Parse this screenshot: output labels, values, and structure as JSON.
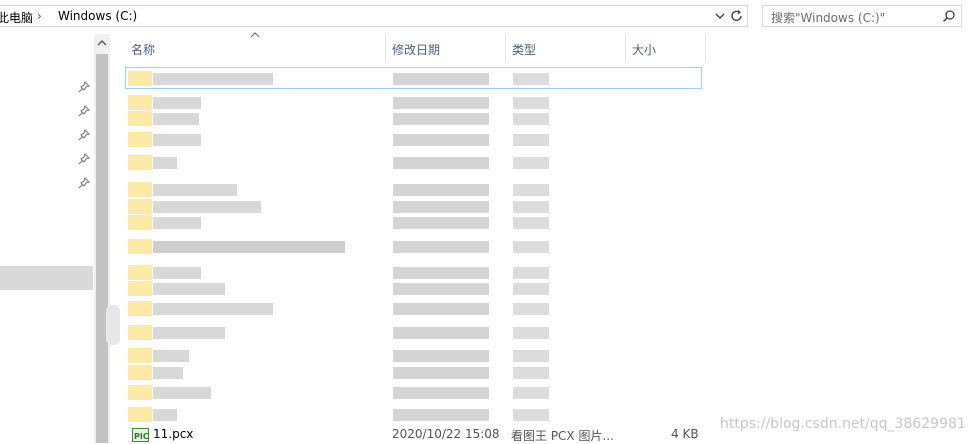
{
  "address": {
    "crumbs": [
      "此电脑",
      "Windows (C:)"
    ]
  },
  "search": {
    "placeholder": "搜索\"Windows (C:)\""
  },
  "columns": {
    "name": "名称",
    "date": "修改日期",
    "type": "类型",
    "size": "大小"
  },
  "file": {
    "name": "11.pcx",
    "date": "2020/10/22 15:08",
    "type": "看图王 PCX 图片...",
    "size": "4 KB"
  },
  "watermark": "https://blog.csdn.net/qq_38629981",
  "colors": {
    "header_text": "#4c607a",
    "folder": "#fde9a8",
    "focus_border": "#99d1ff"
  },
  "icons": {
    "pin": "pin-icon",
    "search": "search-icon",
    "refresh": "refresh-icon",
    "dropdown": "chevron-down-icon"
  }
}
